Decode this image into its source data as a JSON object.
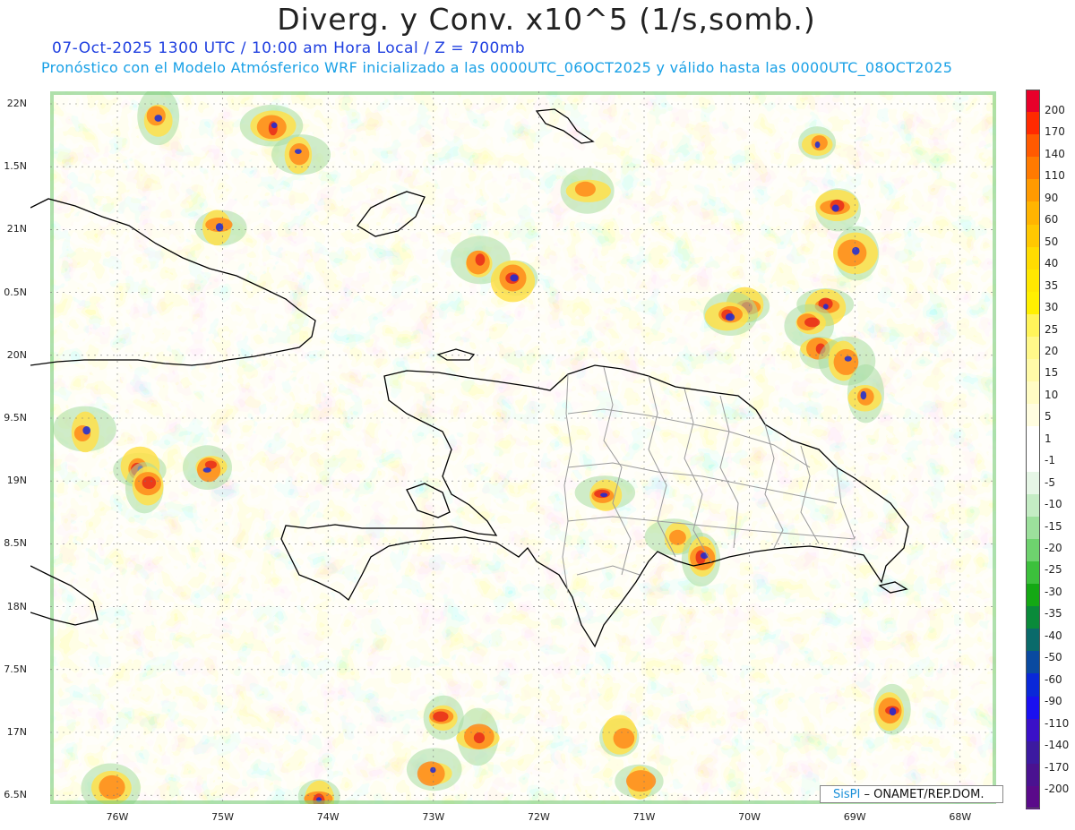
{
  "title": "Diverg. y Conv. x10^5 (1/s,somb.)",
  "subtitle_line1": "07-Oct-2025  1300 UTC / 10:00 am Hora Local / Z = 700mb",
  "subtitle_line2": "Pronóstico con el Modelo Atmósferico WRF inicializado a las 0000UTC_06OCT2025 y válido hasta las  0000UTC_08OCT2025",
  "credit": {
    "logo": "SisPI",
    "text": "– ONAMET/REP.DOM."
  },
  "lat_labels": [
    "22N",
    "1.5N",
    "21N",
    "0.5N",
    "20N",
    "9.5N",
    "19N",
    "8.5N",
    "18N",
    "7.5N",
    "17N",
    "6.5N"
  ],
  "lon_labels": [
    "76W",
    "75W",
    "74W",
    "73W",
    "72W",
    "71W",
    "70W",
    "69W",
    "68W"
  ],
  "colorbar": {
    "labels": [
      "200",
      "170",
      "140",
      "110",
      "90",
      "60",
      "50",
      "40",
      "35",
      "30",
      "25",
      "20",
      "15",
      "10",
      "5",
      "1",
      "-1",
      "-5",
      "-10",
      "-15",
      "-20",
      "-25",
      "-30",
      "-35",
      "-40",
      "-50",
      "-60",
      "-90",
      "-110",
      "-140",
      "-170",
      "-200"
    ],
    "colors": [
      "#e8002a",
      "#ff2a00",
      "#ff5a00",
      "#ff7a00",
      "#ff9a00",
      "#ffb400",
      "#ffc800",
      "#ffdc00",
      "#ffe800",
      "#fff000",
      "#fff45a",
      "#fff88a",
      "#fffaa8",
      "#fffcc4",
      "#fffde0",
      "#ffffff",
      "#ffffff",
      "#e6f6e6",
      "#c4ecc4",
      "#9ce09c",
      "#6ed26e",
      "#3cc03c",
      "#14a814",
      "#0a8a3a",
      "#0a6a6a",
      "#0a4aa0",
      "#0a28d8",
      "#1a10f0",
      "#3a10c8",
      "#3c1aa0",
      "#4a1290",
      "#5a0a8a"
    ]
  },
  "colors": {
    "land_outline": "#000000",
    "province_outline": "#9a9a9a",
    "grid": "#777777"
  }
}
